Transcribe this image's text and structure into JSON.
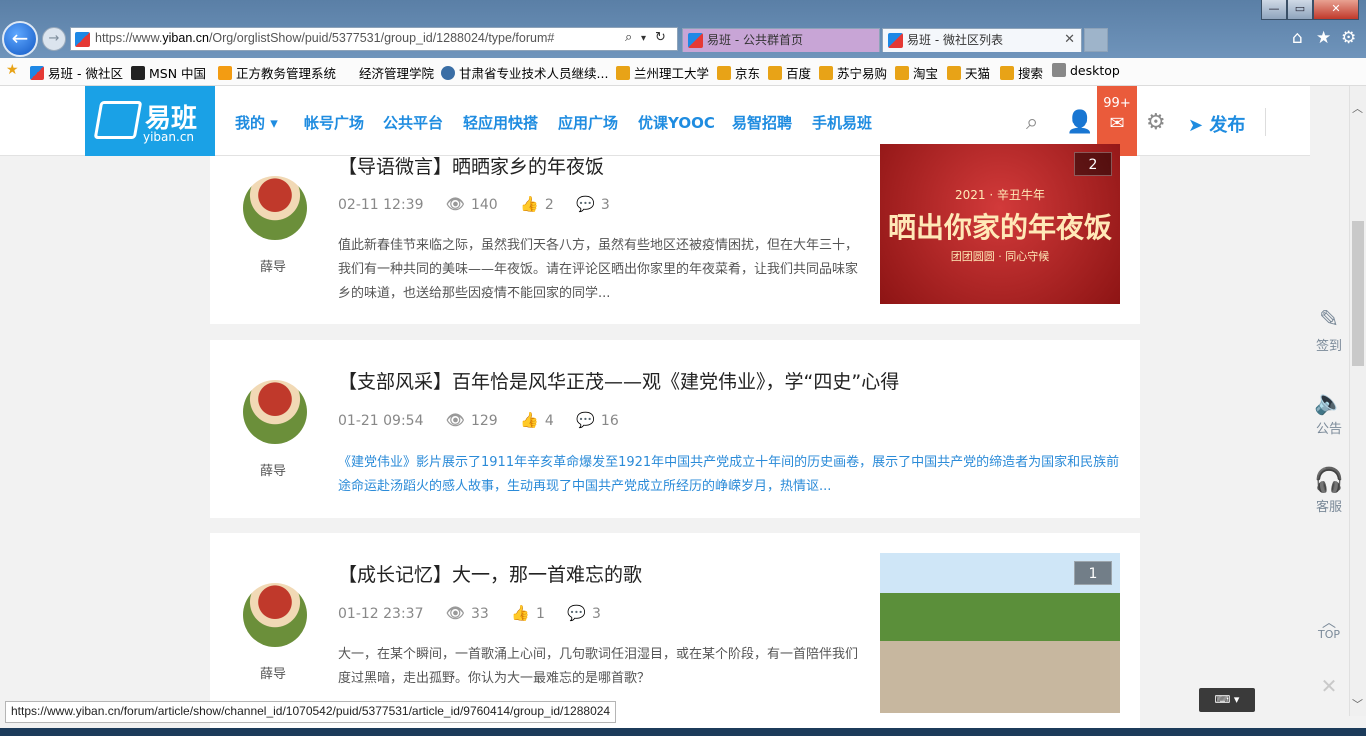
{
  "browser": {
    "url_prefix": "https://www.",
    "url_domain": "yiban.cn",
    "url_path": "/Org/orglistShow/puid/5377531/group_id/1288024/type/forum#",
    "tabs": [
      {
        "label": "易班 - 公共群首页"
      },
      {
        "label": "易班 - 微社区列表"
      }
    ],
    "favorites": [
      {
        "label": "易班 - 微社区",
        "color": "#1e88e5"
      },
      {
        "label": "MSN 中国",
        "color": "#222222"
      },
      {
        "label": "正方教务管理系统",
        "color": "#f39c12"
      },
      {
        "label": "经济管理学院",
        "color": "#ffffff"
      },
      {
        "label": "甘肃省专业技术人员继续...",
        "color": "#3a6ea5"
      },
      {
        "label": "兰州理工大学",
        "color": "#e8a317"
      },
      {
        "label": "京东",
        "color": "#e8a317"
      },
      {
        "label": "百度",
        "color": "#e8a317"
      },
      {
        "label": "苏宁易购",
        "color": "#e8a317"
      },
      {
        "label": "淘宝",
        "color": "#e8a317"
      },
      {
        "label": "天猫",
        "color": "#e8a317"
      },
      {
        "label": "搜索",
        "color": "#e8a317"
      },
      {
        "label": "desktop",
        "color": "#888888"
      }
    ],
    "status_url": "https://www.yiban.cn/forum/article/show/channel_id/1070542/puid/5377531/article_id/9760414/group_id/1288024"
  },
  "site": {
    "logo_cn": "易班",
    "logo_en": "yiban.cn",
    "nav": [
      {
        "label": "我的 ▾"
      },
      {
        "label": "帐号广场"
      },
      {
        "label": "公共平台"
      },
      {
        "label": "轻应用快搭"
      },
      {
        "label": "应用广场"
      },
      {
        "label": "优课YOOC"
      },
      {
        "label": "易智招聘"
      },
      {
        "label": "手机易班"
      }
    ],
    "mail_count": "99+",
    "publish_label": "发布"
  },
  "posts": [
    {
      "title": "【导语微言】晒晒家乡的年夜饭",
      "time": "02-11 12:39",
      "views": "140",
      "likes": "2",
      "comments": "3",
      "author": "薛导",
      "excerpt": "值此新春佳节来临之际，虽然我们天各八方，虽然有些地区还被疫情困扰，但在大年三十，我们有一种共同的美味——年夜饭。请在评论区晒出你家里的年夜菜肴，让我们共同品味家乡的味道，也送给那些因疫情不能回家的同学...",
      "image_count": "2",
      "banner_top": "2021 · 辛丑牛年",
      "banner_main": "晒出你家的年夜饭",
      "banner_sub": "团团圆圆 · 同心守候"
    },
    {
      "title": "【支部风采】百年恰是风华正茂——观《建党伟业》，学“四史”心得",
      "time": "01-21 09:54",
      "views": "129",
      "likes": "4",
      "comments": "16",
      "author": "薛导",
      "excerpt": "《建党伟业》影片展示了1911年辛亥革命爆发至1921年中国共产党成立十年间的历史画卷，展示了中国共产党的缔造者为国家和民族前途命运赴汤蹈火的感人故事，生动再现了中国共产党成立所经历的峥嵘岁月，热情讴..."
    },
    {
      "title": "【成长记忆】大一，那一首难忘的歌",
      "time": "01-12 23:37",
      "views": "33",
      "likes": "1",
      "comments": "3",
      "author": "薛导",
      "excerpt": "大一，在某个瞬间，一首歌涌上心间，几句歌词任泪湿目，或在某个阶段，有一首陪伴我们度过黑暗，走出孤野。你认为大一最难忘的是哪首歌？",
      "image_count": "1"
    }
  ],
  "sidetools": [
    {
      "label": "签到"
    },
    {
      "label": "公告"
    },
    {
      "label": "客服"
    },
    {
      "label": "TOP"
    }
  ]
}
